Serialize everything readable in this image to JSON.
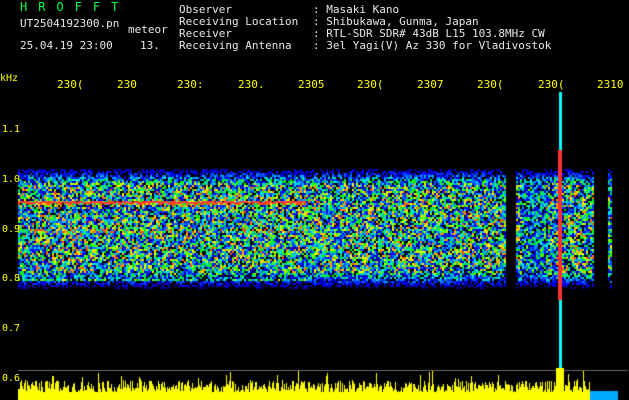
{
  "header": {
    "title": "HROFFT",
    "filename": "UT2504192300.pn",
    "kind": "meteor",
    "date": "25.04.19 23:00",
    "number": "13."
  },
  "info": [
    {
      "label": "Observer",
      "value": ": Masaki Kano"
    },
    {
      "label": "Receiving Location",
      "value": ": Shibukawa, Gunma, Japan"
    },
    {
      "label": "Receiver",
      "value": ": RTL-SDR SDR# 43dB L15 103.8MHz CW"
    },
    {
      "label": "Receiving Antenna",
      "value": ": 3el Yagi(V) Az 330 for Vladivostok"
    }
  ],
  "axis": {
    "unit": "kHz",
    "time_ticks": [
      "230(",
      "230",
      "230:",
      "230.",
      "2305",
      "230(",
      "2307",
      "230(",
      "230(",
      "2310"
    ],
    "freq_ticks": [
      "1.1",
      "1.0",
      "0.9",
      "0.8",
      "0.7",
      "0.6"
    ]
  },
  "colors": {
    "background": "#000000",
    "axis_text": "#ffff00",
    "title_text": "#00ff3c",
    "header_text": "#e8e8e8",
    "signal_line": "#ff3333"
  }
}
